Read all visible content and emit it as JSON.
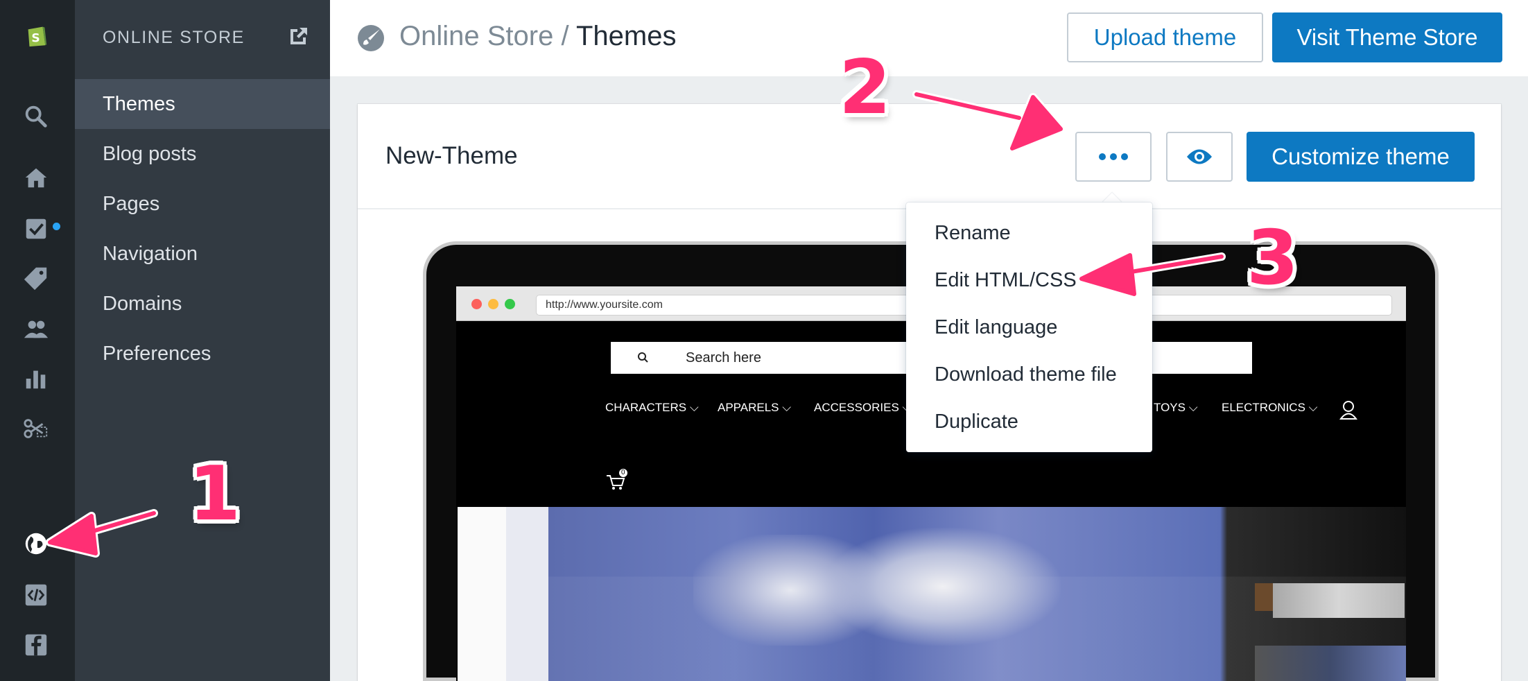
{
  "sidebar": {
    "title": "ONLINE STORE",
    "items": [
      {
        "label": "Themes",
        "active": true
      },
      {
        "label": "Blog posts"
      },
      {
        "label": "Pages"
      },
      {
        "label": "Navigation"
      },
      {
        "label": "Domains"
      },
      {
        "label": "Preferences"
      }
    ]
  },
  "rail": {
    "icons": [
      "shopify-logo-icon",
      "search-icon",
      "home-icon",
      "orders-icon",
      "products-tag-icon",
      "customers-icon",
      "analytics-icon",
      "discounts-icon",
      "online-store-globe-icon",
      "apps-code-icon",
      "facebook-icon"
    ]
  },
  "header": {
    "breadcrumb_parent": "Online Store",
    "breadcrumb_sep": "/",
    "breadcrumb_current": "Themes",
    "upload_label": "Upload theme",
    "visit_label": "Visit Theme Store"
  },
  "theme": {
    "name": "New-Theme",
    "customize_label": "Customize theme"
  },
  "dropdown": {
    "items": [
      "Rename",
      "Edit HTML/CSS",
      "Edit language",
      "Download theme file",
      "Duplicate"
    ]
  },
  "preview": {
    "url": "http://www.yoursite.com",
    "search_placeholder": "Search here",
    "nav": [
      "CHARACTERS",
      "APPARELS",
      "ACCESSORIES",
      "TOYS",
      "ELECTRONICS"
    ],
    "cart_count": "0"
  },
  "annotations": {
    "step1": "1",
    "step2": "2",
    "step3": "3"
  },
  "colors": {
    "accent": "#0d79c2",
    "annotation": "#ff2f74",
    "rail_bg": "#1f2529",
    "sidebar_bg": "#323a42"
  }
}
